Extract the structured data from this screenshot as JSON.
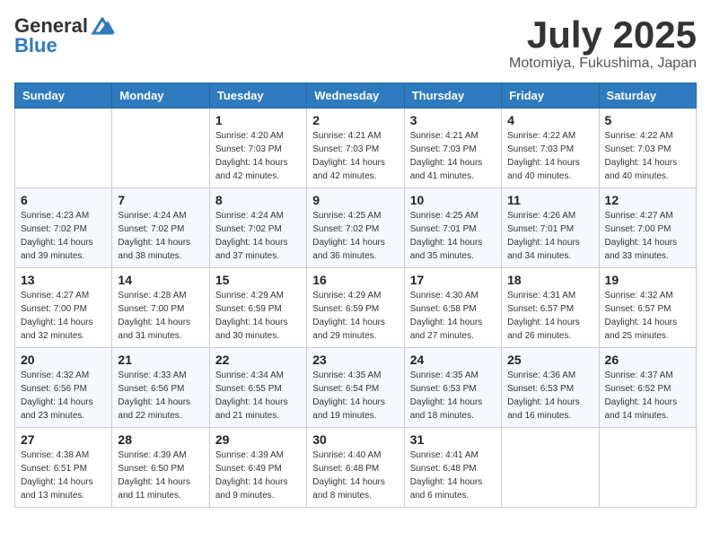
{
  "header": {
    "logo_general": "General",
    "logo_blue": "Blue",
    "month_title": "July 2025",
    "location": "Motomiya, Fukushima, Japan"
  },
  "weekdays": [
    "Sunday",
    "Monday",
    "Tuesday",
    "Wednesday",
    "Thursday",
    "Friday",
    "Saturday"
  ],
  "weeks": [
    [
      {
        "day": "",
        "sunrise": "",
        "sunset": "",
        "daylight": ""
      },
      {
        "day": "",
        "sunrise": "",
        "sunset": "",
        "daylight": ""
      },
      {
        "day": "1",
        "sunrise": "Sunrise: 4:20 AM",
        "sunset": "Sunset: 7:03 PM",
        "daylight": "Daylight: 14 hours and 42 minutes."
      },
      {
        "day": "2",
        "sunrise": "Sunrise: 4:21 AM",
        "sunset": "Sunset: 7:03 PM",
        "daylight": "Daylight: 14 hours and 42 minutes."
      },
      {
        "day": "3",
        "sunrise": "Sunrise: 4:21 AM",
        "sunset": "Sunset: 7:03 PM",
        "daylight": "Daylight: 14 hours and 41 minutes."
      },
      {
        "day": "4",
        "sunrise": "Sunrise: 4:22 AM",
        "sunset": "Sunset: 7:03 PM",
        "daylight": "Daylight: 14 hours and 40 minutes."
      },
      {
        "day": "5",
        "sunrise": "Sunrise: 4:22 AM",
        "sunset": "Sunset: 7:03 PM",
        "daylight": "Daylight: 14 hours and 40 minutes."
      }
    ],
    [
      {
        "day": "6",
        "sunrise": "Sunrise: 4:23 AM",
        "sunset": "Sunset: 7:02 PM",
        "daylight": "Daylight: 14 hours and 39 minutes."
      },
      {
        "day": "7",
        "sunrise": "Sunrise: 4:24 AM",
        "sunset": "Sunset: 7:02 PM",
        "daylight": "Daylight: 14 hours and 38 minutes."
      },
      {
        "day": "8",
        "sunrise": "Sunrise: 4:24 AM",
        "sunset": "Sunset: 7:02 PM",
        "daylight": "Daylight: 14 hours and 37 minutes."
      },
      {
        "day": "9",
        "sunrise": "Sunrise: 4:25 AM",
        "sunset": "Sunset: 7:02 PM",
        "daylight": "Daylight: 14 hours and 36 minutes."
      },
      {
        "day": "10",
        "sunrise": "Sunrise: 4:25 AM",
        "sunset": "Sunset: 7:01 PM",
        "daylight": "Daylight: 14 hours and 35 minutes."
      },
      {
        "day": "11",
        "sunrise": "Sunrise: 4:26 AM",
        "sunset": "Sunset: 7:01 PM",
        "daylight": "Daylight: 14 hours and 34 minutes."
      },
      {
        "day": "12",
        "sunrise": "Sunrise: 4:27 AM",
        "sunset": "Sunset: 7:00 PM",
        "daylight": "Daylight: 14 hours and 33 minutes."
      }
    ],
    [
      {
        "day": "13",
        "sunrise": "Sunrise: 4:27 AM",
        "sunset": "Sunset: 7:00 PM",
        "daylight": "Daylight: 14 hours and 32 minutes."
      },
      {
        "day": "14",
        "sunrise": "Sunrise: 4:28 AM",
        "sunset": "Sunset: 7:00 PM",
        "daylight": "Daylight: 14 hours and 31 minutes."
      },
      {
        "day": "15",
        "sunrise": "Sunrise: 4:29 AM",
        "sunset": "Sunset: 6:59 PM",
        "daylight": "Daylight: 14 hours and 30 minutes."
      },
      {
        "day": "16",
        "sunrise": "Sunrise: 4:29 AM",
        "sunset": "Sunset: 6:59 PM",
        "daylight": "Daylight: 14 hours and 29 minutes."
      },
      {
        "day": "17",
        "sunrise": "Sunrise: 4:30 AM",
        "sunset": "Sunset: 6:58 PM",
        "daylight": "Daylight: 14 hours and 27 minutes."
      },
      {
        "day": "18",
        "sunrise": "Sunrise: 4:31 AM",
        "sunset": "Sunset: 6:57 PM",
        "daylight": "Daylight: 14 hours and 26 minutes."
      },
      {
        "day": "19",
        "sunrise": "Sunrise: 4:32 AM",
        "sunset": "Sunset: 6:57 PM",
        "daylight": "Daylight: 14 hours and 25 minutes."
      }
    ],
    [
      {
        "day": "20",
        "sunrise": "Sunrise: 4:32 AM",
        "sunset": "Sunset: 6:56 PM",
        "daylight": "Daylight: 14 hours and 23 minutes."
      },
      {
        "day": "21",
        "sunrise": "Sunrise: 4:33 AM",
        "sunset": "Sunset: 6:56 PM",
        "daylight": "Daylight: 14 hours and 22 minutes."
      },
      {
        "day": "22",
        "sunrise": "Sunrise: 4:34 AM",
        "sunset": "Sunset: 6:55 PM",
        "daylight": "Daylight: 14 hours and 21 minutes."
      },
      {
        "day": "23",
        "sunrise": "Sunrise: 4:35 AM",
        "sunset": "Sunset: 6:54 PM",
        "daylight": "Daylight: 14 hours and 19 minutes."
      },
      {
        "day": "24",
        "sunrise": "Sunrise: 4:35 AM",
        "sunset": "Sunset: 6:53 PM",
        "daylight": "Daylight: 14 hours and 18 minutes."
      },
      {
        "day": "25",
        "sunrise": "Sunrise: 4:36 AM",
        "sunset": "Sunset: 6:53 PM",
        "daylight": "Daylight: 14 hours and 16 minutes."
      },
      {
        "day": "26",
        "sunrise": "Sunrise: 4:37 AM",
        "sunset": "Sunset: 6:52 PM",
        "daylight": "Daylight: 14 hours and 14 minutes."
      }
    ],
    [
      {
        "day": "27",
        "sunrise": "Sunrise: 4:38 AM",
        "sunset": "Sunset: 6:51 PM",
        "daylight": "Daylight: 14 hours and 13 minutes."
      },
      {
        "day": "28",
        "sunrise": "Sunrise: 4:39 AM",
        "sunset": "Sunset: 6:50 PM",
        "daylight": "Daylight: 14 hours and 11 minutes."
      },
      {
        "day": "29",
        "sunrise": "Sunrise: 4:39 AM",
        "sunset": "Sunset: 6:49 PM",
        "daylight": "Daylight: 14 hours and 9 minutes."
      },
      {
        "day": "30",
        "sunrise": "Sunrise: 4:40 AM",
        "sunset": "Sunset: 6:48 PM",
        "daylight": "Daylight: 14 hours and 8 minutes."
      },
      {
        "day": "31",
        "sunrise": "Sunrise: 4:41 AM",
        "sunset": "Sunset: 6:48 PM",
        "daylight": "Daylight: 14 hours and 6 minutes."
      },
      {
        "day": "",
        "sunrise": "",
        "sunset": "",
        "daylight": ""
      },
      {
        "day": "",
        "sunrise": "",
        "sunset": "",
        "daylight": ""
      }
    ]
  ]
}
